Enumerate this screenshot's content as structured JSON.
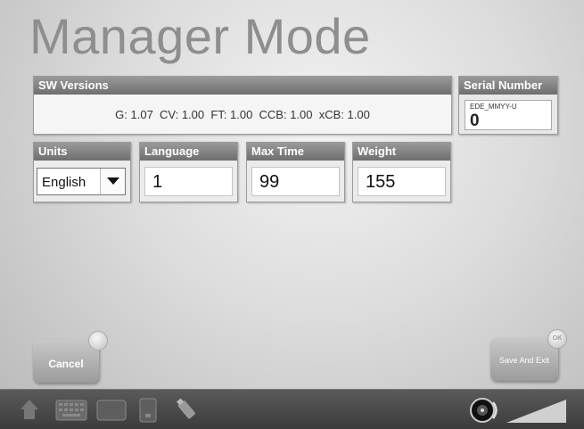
{
  "title": "Manager Mode",
  "sw_versions": {
    "header": "SW Versions",
    "line": "G: 1.07  CV: 1.00  FT: 1.00  CCB: 1.00  xCB: 1.00"
  },
  "serial_number": {
    "header": "Serial Number",
    "format_hint": "EDE_MMYY-U",
    "value": "0"
  },
  "fields": {
    "units": {
      "label": "Units",
      "value": "English"
    },
    "language": {
      "label": "Language",
      "value": "1"
    },
    "max_time": {
      "label": "Max Time",
      "value": "99"
    },
    "weight": {
      "label": "Weight",
      "value": "155"
    }
  },
  "buttons": {
    "cancel": "Cancel",
    "save": "Save And Exit",
    "save_knob": "OK"
  },
  "taskbar": {
    "icons": [
      "home-icon",
      "keyboard-icon",
      "monitor-icon",
      "device-icon",
      "usb-icon",
      "speaker-icon",
      "volume-level-icon"
    ]
  },
  "colors": {
    "header_gray": "#6e6e6e",
    "background": "#dcdcdc",
    "taskbar": "#4a4a4a"
  }
}
